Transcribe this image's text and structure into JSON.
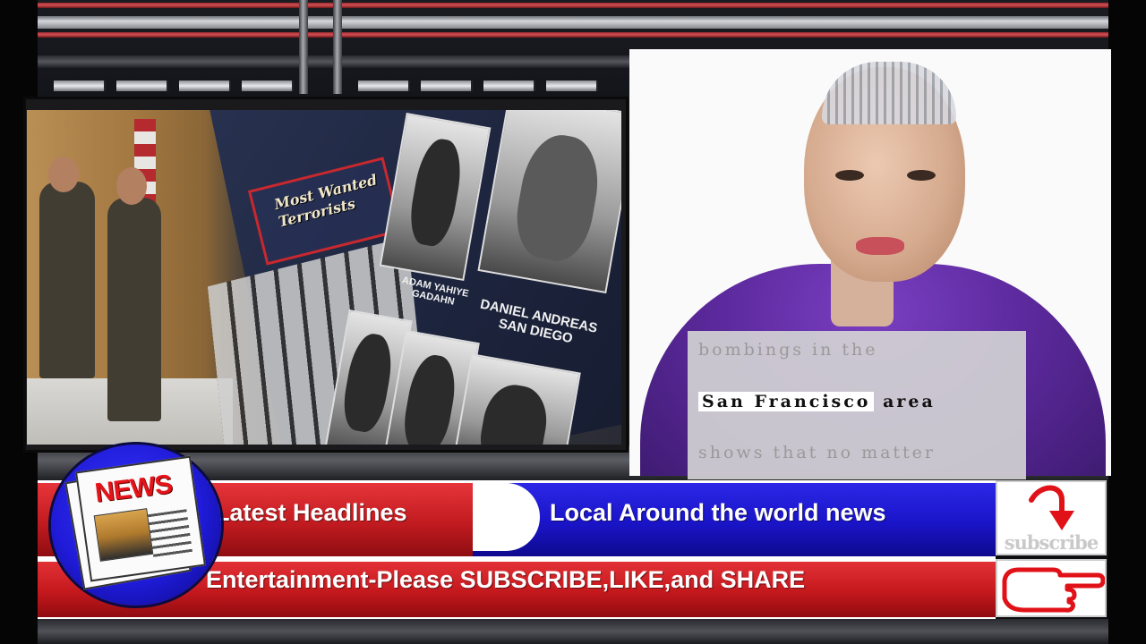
{
  "caption": {
    "line1": "bombings in the",
    "line2_highlight": "San Francisco",
    "line2_rest": " area",
    "line3": "shows that no matter"
  },
  "photo": {
    "banner": "Most Wanted Terrorists",
    "caption_left": "ADAM YAHIYE GADAHN",
    "caption_right": "DANIEL ANDREAS SAN DIEGO"
  },
  "ticker": {
    "headline_label": "Latest Headlines",
    "news_label": "Local Around the world news",
    "bottom_line": "Entertainment-Please SUBSCRIBE,LIKE,and SHARE"
  },
  "logo": {
    "word": "NEWS"
  },
  "subscribe": {
    "label": "subscribe"
  },
  "colors": {
    "red_bar": "#c11b20",
    "blue_bar": "#1a14c8",
    "logo_disc": "#1f1bd8",
    "subscribe_red": "#e01218",
    "robot_hoodie": "#5d2a9e"
  },
  "icons": {
    "arrow": "curved-arrow-down-icon",
    "hand": "pointing-hand-icon",
    "newspaper": "newspaper-icon"
  }
}
